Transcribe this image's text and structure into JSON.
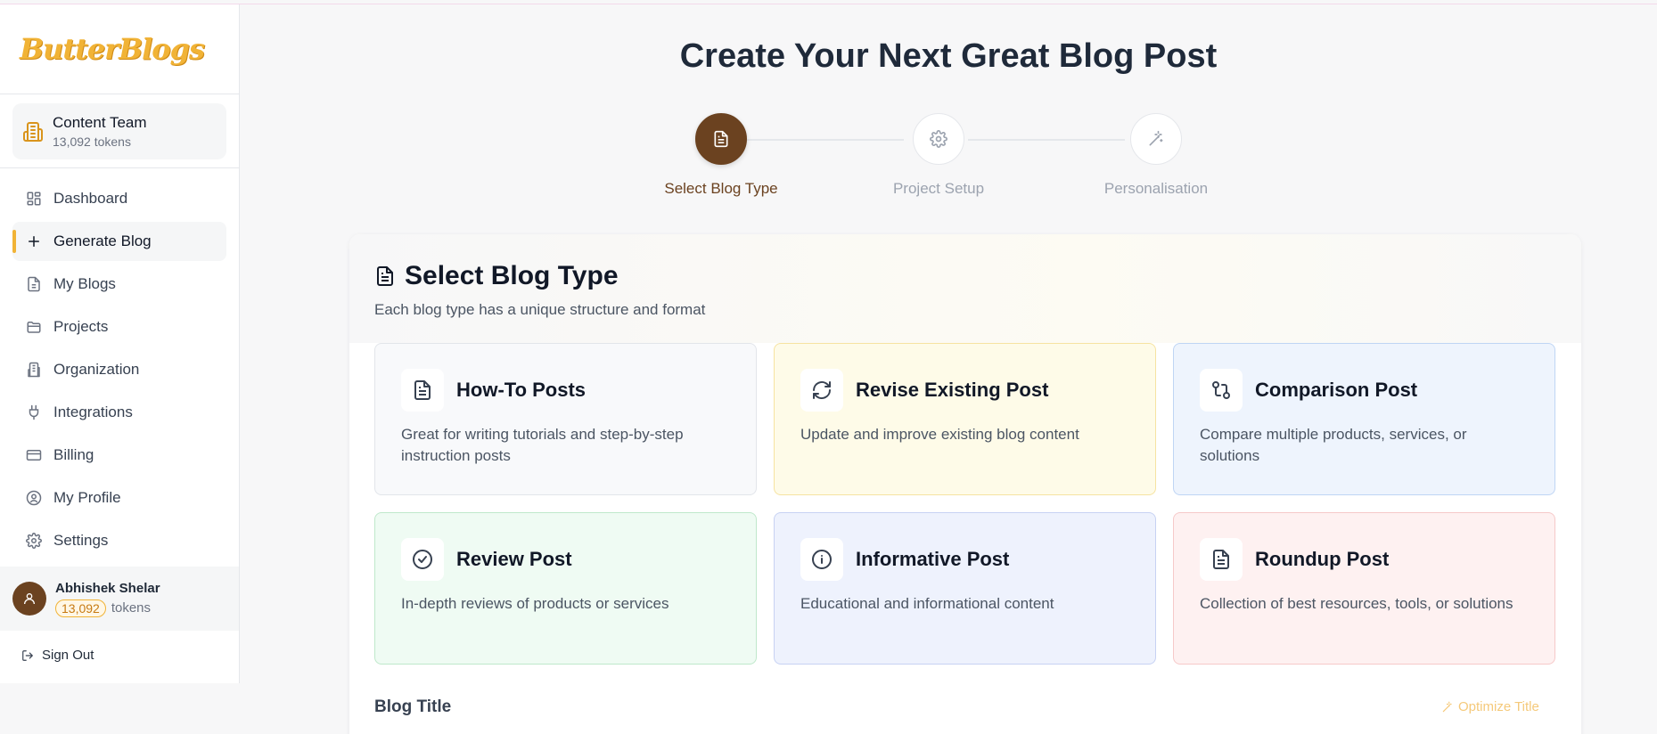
{
  "app": {
    "logo_text": "ButterBlogs"
  },
  "team": {
    "name": "Content Team",
    "tokens": "13,092 tokens"
  },
  "nav": [
    {
      "label": "Dashboard",
      "icon": "dashboard-icon",
      "active": false
    },
    {
      "label": "Generate Blog",
      "icon": "plus-icon",
      "active": true
    },
    {
      "label": "My Blogs",
      "icon": "file-icon",
      "active": false
    },
    {
      "label": "Projects",
      "icon": "folder-icon",
      "active": false
    },
    {
      "label": "Organization",
      "icon": "building-icon",
      "active": false
    },
    {
      "label": "Integrations",
      "icon": "plug-icon",
      "active": false
    },
    {
      "label": "Billing",
      "icon": "credit-card-icon",
      "active": false
    },
    {
      "label": "My Profile",
      "icon": "user-circle-icon",
      "active": false
    },
    {
      "label": "Settings",
      "icon": "gear-icon",
      "active": false
    }
  ],
  "user": {
    "name": "Abhishek Shelar",
    "tokens_value": "13,092",
    "tokens_label": "tokens"
  },
  "signout": {
    "label": "Sign Out"
  },
  "page": {
    "title": "Create Your Next Great Blog Post"
  },
  "steps": [
    {
      "label": "Select Blog Type",
      "icon": "document-icon",
      "active": true
    },
    {
      "label": "Project Setup",
      "icon": "gear-icon",
      "active": false
    },
    {
      "label": "Personalisation",
      "icon": "magic-wand-icon",
      "active": false
    }
  ],
  "section": {
    "title": "Select Blog Type",
    "subtitle": "Each blog type has a unique structure and format"
  },
  "blog_types": [
    {
      "title": "How-To Posts",
      "description": "Great for writing tutorials and step-by-step instruction posts",
      "icon": "document-icon",
      "bg": "#f8f9fb",
      "border": "#e2e5ea"
    },
    {
      "title": "Revise Existing Post",
      "description": "Update and improve existing blog content",
      "icon": "refresh-icon",
      "bg": "#fefbe8",
      "border": "#f6e3a1"
    },
    {
      "title": "Comparison Post",
      "description": "Compare multiple products, services, or solutions",
      "icon": "compare-icon",
      "bg": "#eef4fd",
      "border": "#bfd5f4"
    },
    {
      "title": "Review Post",
      "description": "In-depth reviews of products or services",
      "icon": "check-circle-icon",
      "bg": "#effbf3",
      "border": "#bfe8cb"
    },
    {
      "title": "Informative Post",
      "description": "Educational and informational content",
      "icon": "info-icon",
      "bg": "#eef2fd",
      "border": "#c7d2f3"
    },
    {
      "title": "Roundup Post",
      "description": "Collection of best resources, tools, or solutions",
      "icon": "document-icon",
      "bg": "#fef1f1",
      "border": "#f6c9c9"
    }
  ],
  "form": {
    "blog_title_label": "Blog Title",
    "optimize_label": "Optimize Title"
  },
  "colors": {
    "accent": "#f1b336",
    "brand_brown": "#6b4220"
  }
}
